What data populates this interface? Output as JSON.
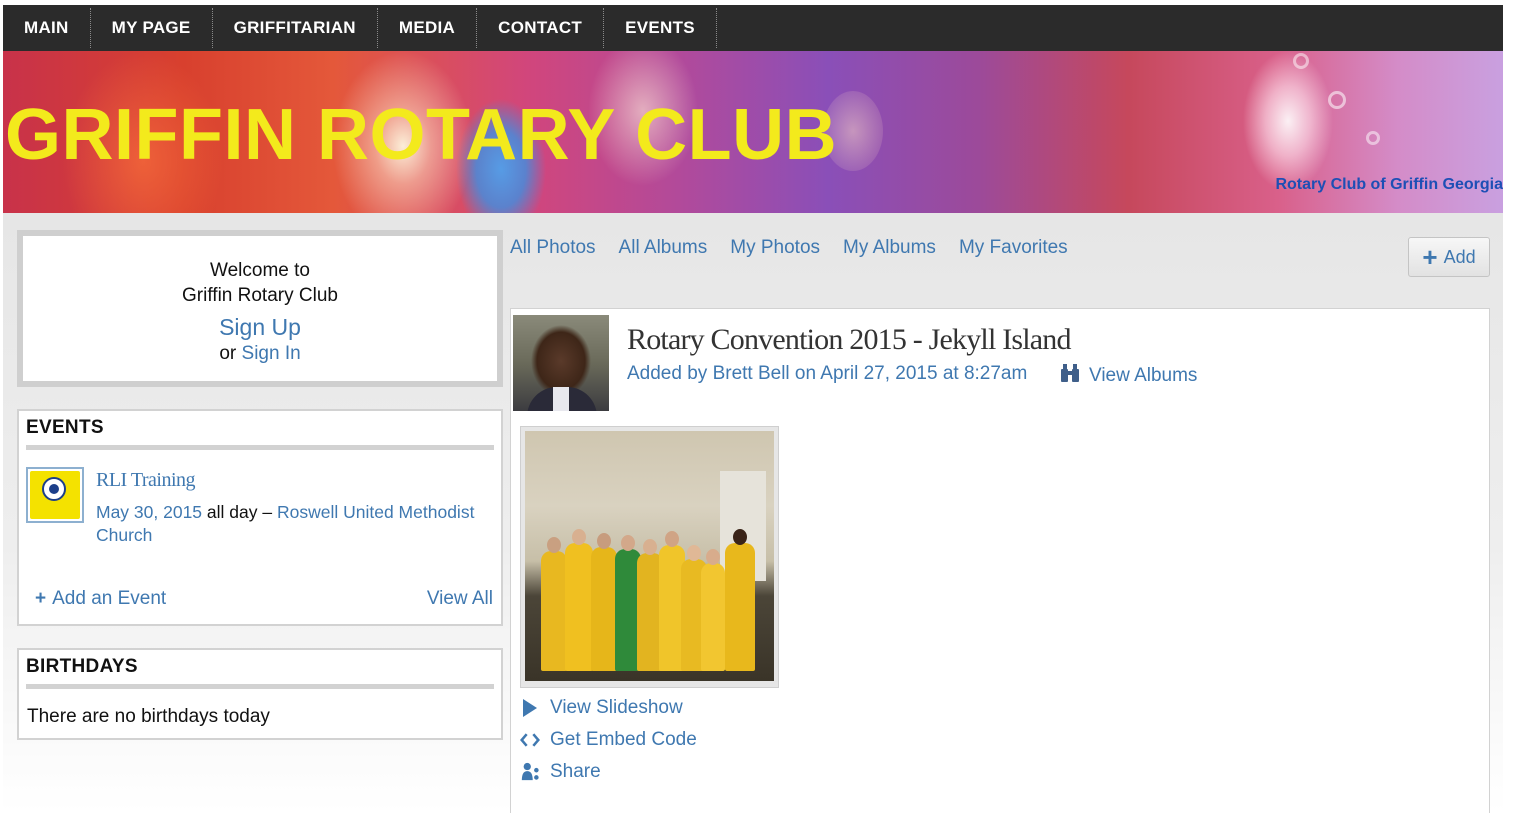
{
  "nav": {
    "items": [
      "MAIN",
      "MY PAGE",
      "GRIFFITARIAN",
      "MEDIA",
      "CONTACT",
      "EVENTS"
    ]
  },
  "banner": {
    "title": "GRIFFIN ROTARY CLUB",
    "subtitle": "Rotary Club of Griffin Georgia"
  },
  "welcome": {
    "line1": "Welcome to",
    "line2": "Griffin Rotary Club",
    "sign_up": "Sign Up",
    "or": "or",
    "sign_in": "Sign In"
  },
  "events": {
    "heading": "EVENTS",
    "item": {
      "title": "RLI Training",
      "date": "May 30, 2015",
      "time": "all day –",
      "location": "Roswell United Methodist Church"
    },
    "add_label": "Add an Event",
    "view_all": "View All"
  },
  "birthdays": {
    "heading": "BIRTHDAYS",
    "text": "There are no birthdays today"
  },
  "tabs": [
    "All Photos",
    "All Albums",
    "My Photos",
    "My Albums",
    "My Favorites"
  ],
  "add_button": "Add",
  "album": {
    "title": "Rotary Convention 2015 - Jekyll Island",
    "meta": "Added by Brett Bell on April 27, 2015 at 8:27am",
    "view_albums": "View Albums"
  },
  "actions": {
    "slideshow": "View Slideshow",
    "embed": "Get Embed Code",
    "share": "Share"
  },
  "colors": {
    "link": "#3f78b0",
    "title_yellow": "#f3ea1c",
    "nav_bg": "#2b2b2b"
  }
}
